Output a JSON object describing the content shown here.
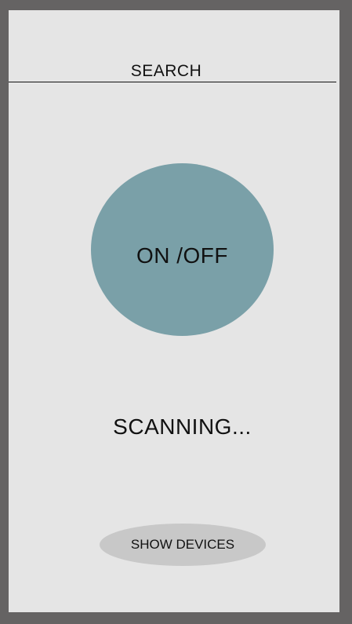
{
  "header": {
    "search_label": "SEARCH"
  },
  "power": {
    "label": "ON /OFF"
  },
  "status": {
    "text": "SCANNING..."
  },
  "devices": {
    "label": "SHOW DEVICES"
  },
  "colors": {
    "frame": "#656363",
    "background": "#e5e5e5",
    "power_button": "#7aa0a8",
    "devices_button": "#c8c8c8"
  }
}
